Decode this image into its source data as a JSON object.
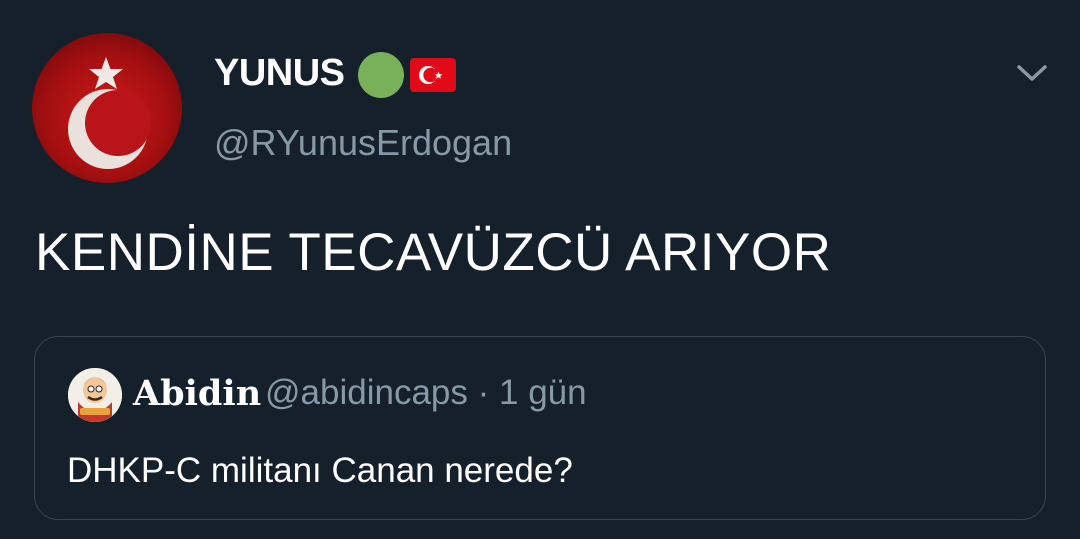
{
  "tweet": {
    "author": {
      "display_name": "YUNUS",
      "handle": "@RYunusErdogan",
      "avatar_icon": "turkish-flag-avatar",
      "badges": [
        "green-circle-emoji",
        "turkey-flag-emoji"
      ]
    },
    "text": "KENDİNE TECAVÜZCÜ ARIYOR",
    "menu_icon": "chevron-down-icon"
  },
  "quoted_tweet": {
    "author_name": "Abidin",
    "handle": "@abidincaps",
    "separator": "·",
    "time": "1 gün",
    "text": "DHKP-C militanı Canan nerede?",
    "avatar_icon": "cartoon-character-avatar"
  },
  "colors": {
    "background": "#15202b",
    "primary_text": "#ffffff",
    "secondary_text": "#8899a6",
    "border": "#38444d",
    "flag_red": "#e30a17",
    "green_dot": "#78b159"
  }
}
